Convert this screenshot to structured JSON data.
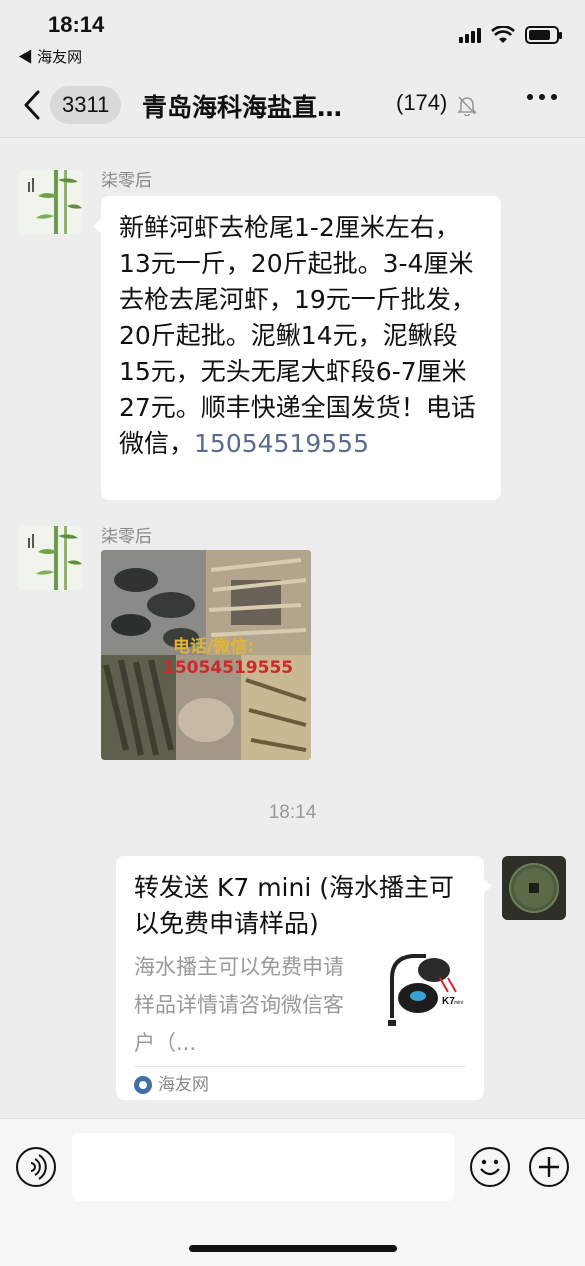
{
  "status_bar": {
    "time": "18:14",
    "back_app": "◀ 海友网"
  },
  "nav": {
    "unread_badge": "3311",
    "title": "青岛海科海盐直…",
    "member_count": "(174)"
  },
  "messages": [
    {
      "sender": "柒零后",
      "text": "新鲜河虾去枪尾1-2厘米左右，13元一斤，20斤起批。3-4厘米去枪去尾河虾，19元一斤批发，20斤起批。泥鳅14元，泥鳅段15元，无头无尾大虾段6-7厘米27元。顺丰快递全国发货！电话微信，",
      "phone": "15054519555"
    },
    {
      "sender": "柒零后",
      "image_overlay_label": "电话/微信:",
      "image_overlay_phone": "15054519555"
    }
  ],
  "timestamp": "18:14",
  "shared_card": {
    "title": "转发送 K7 mini (海水播主可以免费申请样品)",
    "description": "海水播主可以免费申请样品详情请咨询微信客户（...",
    "source": "海友网",
    "thumb_brand": "K7",
    "thumb_model": "mini"
  },
  "colors": {
    "background": "#ededed",
    "bubble": "#ffffff",
    "link": "#5a6b8c"
  }
}
